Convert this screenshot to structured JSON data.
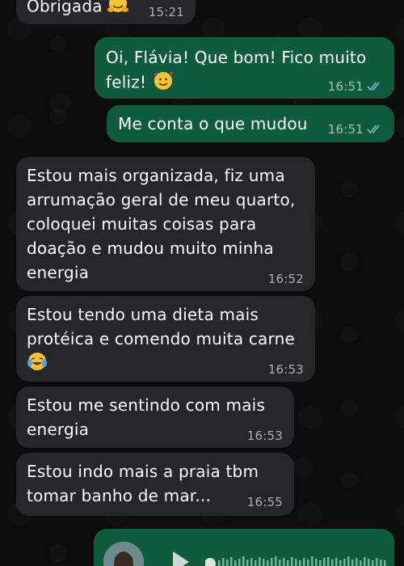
{
  "messages": [
    {
      "text": "Obrigada",
      "time": "15:21",
      "emoji": "hugging"
    },
    {
      "text": "Oi, Flávia! Que bom! Fico muito feliz!",
      "time": "16:51",
      "emoji": "smiling-hearts"
    },
    {
      "text": "Me conta o que mudou",
      "time": "16:51"
    },
    {
      "line1": "Estou mais organizada, fiz uma",
      "line2": "arrumação geral de meu quarto,",
      "line3": "coloquei muitas coisas para",
      "line4": "doação e mudou muito minha",
      "line5": "energia",
      "time": "16:52"
    },
    {
      "line1": "Estou tendo uma dieta mais",
      "line2": "protéica e comendo muita carne",
      "time": "16:53",
      "emoji": "tears-of-joy"
    },
    {
      "line1": "Estou me sentindo com mais",
      "line2": "energia",
      "time": "16:53"
    },
    {
      "line1": "Estou indo mais a praia tbm",
      "line2": "tomar banho de mar...",
      "time": "16:55"
    }
  ],
  "colors": {
    "incoming": "#262628",
    "outgoing": "#0e5b3e",
    "read_ticks": "#8fb8c8"
  }
}
